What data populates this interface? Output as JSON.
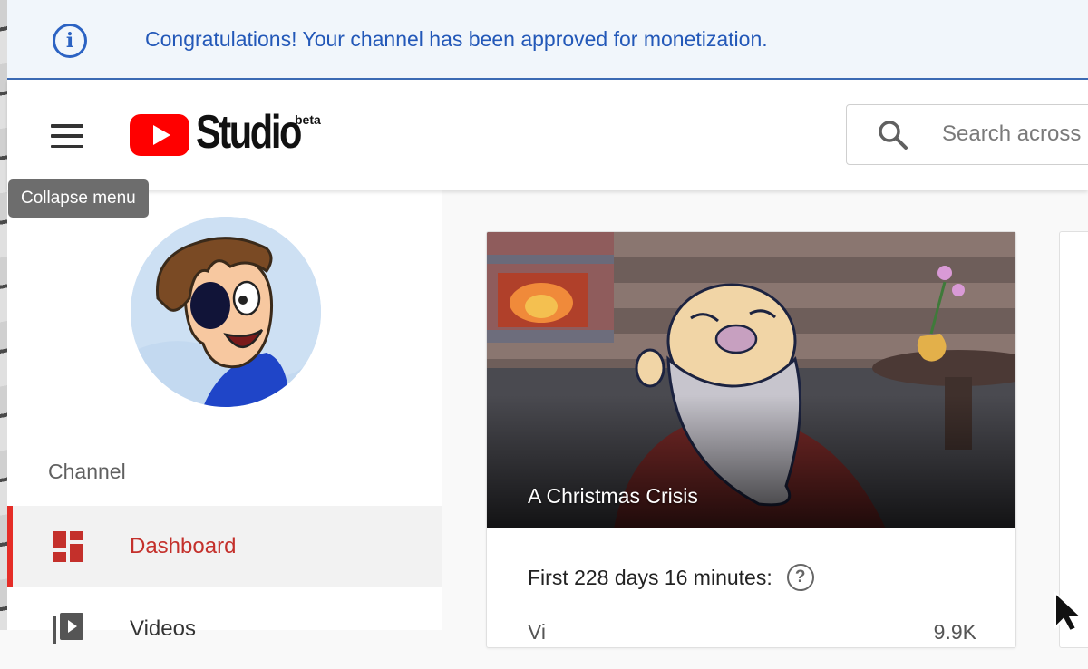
{
  "banner": {
    "icon": "info-icon",
    "message": "Congratulations! Your channel has been approved for monetization."
  },
  "header": {
    "menu_icon": "hamburger-icon",
    "logo_icon": "youtube-logo-icon",
    "app_name": "Studio",
    "badge": "beta",
    "search": {
      "icon": "search-icon",
      "placeholder": "Search across"
    }
  },
  "tooltip": {
    "text": "Collapse menu"
  },
  "sidebar": {
    "section_label": "Channel",
    "items": [
      {
        "label": "Dashboard",
        "icon": "dashboard-icon",
        "active": true
      },
      {
        "label": "Videos",
        "icon": "videos-icon",
        "active": false
      }
    ]
  },
  "main": {
    "video_card": {
      "title": "A Christmas Crisis",
      "stat_heading": "First 228 days 16 minutes:",
      "help_icon": "help-icon",
      "help_glyph": "?",
      "stat_row": {
        "label": "Vi",
        "value": "9.9K"
      }
    }
  },
  "colors": {
    "accent_red": "#e52d27",
    "banner_blue": "#2358b8",
    "banner_bg": "#f1f6fb"
  }
}
